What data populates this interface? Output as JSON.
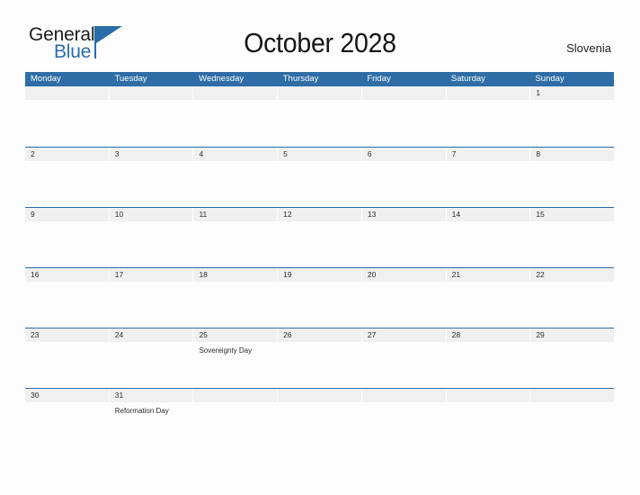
{
  "brand": {
    "word_one": "General",
    "word_two": "Blue",
    "flag_icon": "blue-triangle-flag",
    "accent_color": "#2a6ca8"
  },
  "header": {
    "title": "October 2028",
    "country": "Slovenia"
  },
  "theme": {
    "header_blue": "#2e6da5",
    "separator_blue": "#2a6ca8",
    "strip_gray": "#f0f0f0",
    "page_background": "#fdfdfd",
    "text_color": "#2b2b2b"
  },
  "calendar": {
    "weekdays": [
      "Monday",
      "Tuesday",
      "Wednesday",
      "Thursday",
      "Friday",
      "Saturday",
      "Sunday"
    ],
    "weeks": [
      [
        {
          "day": "",
          "event": ""
        },
        {
          "day": "",
          "event": ""
        },
        {
          "day": "",
          "event": ""
        },
        {
          "day": "",
          "event": ""
        },
        {
          "day": "",
          "event": ""
        },
        {
          "day": "",
          "event": ""
        },
        {
          "day": "1",
          "event": ""
        }
      ],
      [
        {
          "day": "2",
          "event": ""
        },
        {
          "day": "3",
          "event": ""
        },
        {
          "day": "4",
          "event": ""
        },
        {
          "day": "5",
          "event": ""
        },
        {
          "day": "6",
          "event": ""
        },
        {
          "day": "7",
          "event": ""
        },
        {
          "day": "8",
          "event": ""
        }
      ],
      [
        {
          "day": "9",
          "event": ""
        },
        {
          "day": "10",
          "event": ""
        },
        {
          "day": "11",
          "event": ""
        },
        {
          "day": "12",
          "event": ""
        },
        {
          "day": "13",
          "event": ""
        },
        {
          "day": "14",
          "event": ""
        },
        {
          "day": "15",
          "event": ""
        }
      ],
      [
        {
          "day": "16",
          "event": ""
        },
        {
          "day": "17",
          "event": ""
        },
        {
          "day": "18",
          "event": ""
        },
        {
          "day": "19",
          "event": ""
        },
        {
          "day": "20",
          "event": ""
        },
        {
          "day": "21",
          "event": ""
        },
        {
          "day": "22",
          "event": ""
        }
      ],
      [
        {
          "day": "23",
          "event": ""
        },
        {
          "day": "24",
          "event": ""
        },
        {
          "day": "25",
          "event": "Sovereignty Day"
        },
        {
          "day": "26",
          "event": ""
        },
        {
          "day": "27",
          "event": ""
        },
        {
          "day": "28",
          "event": ""
        },
        {
          "day": "29",
          "event": ""
        }
      ],
      [
        {
          "day": "30",
          "event": ""
        },
        {
          "day": "31",
          "event": "Reformation Day"
        },
        {
          "day": "",
          "event": ""
        },
        {
          "day": "",
          "event": ""
        },
        {
          "day": "",
          "event": ""
        },
        {
          "day": "",
          "event": ""
        },
        {
          "day": "",
          "event": ""
        }
      ]
    ]
  }
}
